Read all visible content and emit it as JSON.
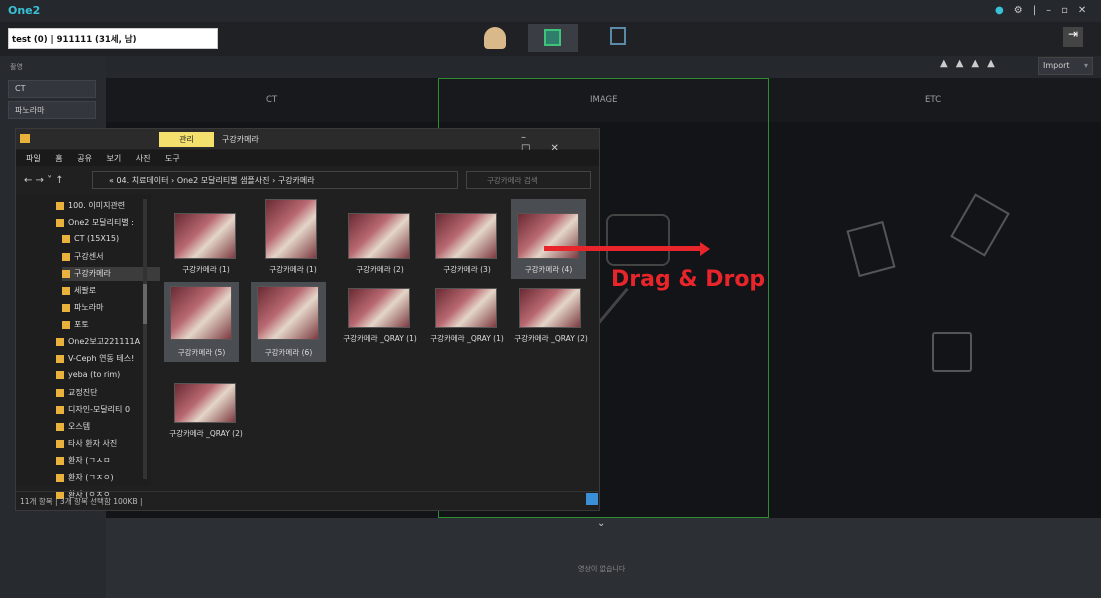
{
  "app": {
    "title": "One2",
    "window_controls": [
      "●",
      "⚙",
      "|",
      "–",
      "▫",
      "✕"
    ]
  },
  "patient": {
    "text": "test  (0) | 911111 (31세, 남)"
  },
  "sidebar": {
    "section": "촬영",
    "items": [
      {
        "label": "CT"
      },
      {
        "label": "파노라마"
      }
    ]
  },
  "toolbar": {
    "import_label": "Import"
  },
  "columns": {
    "ct": "CT",
    "image": "IMAGE",
    "etc": "ETC"
  },
  "bottom": {
    "empty_text": "영상이 없습니다"
  },
  "explorer": {
    "tab_manage": "관리",
    "title": "구강카메라",
    "ribbon": [
      "파일",
      "홈",
      "공유",
      "보기",
      "사진 도구"
    ],
    "path": [
      "« 04. 치료데이터",
      "One2 모달리티별 샘플사진",
      "구강카메라"
    ],
    "search_placeholder": "구강카메라 검색",
    "tree": [
      "100. 이미지관련",
      "One2 모달리티별 :",
      "CT (15X15)",
      "구강센서",
      "구강카메라",
      "세팔로",
      "파노라마",
      "포토",
      "One2보고221111A",
      "V-Ceph 연동 테스!",
      "yeba (to rim)",
      "교정진단",
      "디자인-모달리티 0",
      "오스템",
      "타사 환자 사진",
      "환자 (ㄱㅅㅁ",
      "환자 (ㄱㅈㅇ)",
      "환자 (ㅇㅈㅇ"
    ],
    "files": [
      "구강카메라 (1)",
      "구강카메라 (1)",
      "구강카메라 (2)",
      "구강카메라 (3)",
      "구강카메라 (4)",
      "구강카메라 (5)",
      "구강카메라 (6)",
      "구강카메라 _QRAY (1)",
      "구강카메라 _QRAY (1)",
      "구강카메라 _QRAY (2)",
      "구강카메라 _QRAY (2)"
    ],
    "status": "11개 항목  |  3개 항목 선택함 100KB  |"
  },
  "annotation": {
    "drag_drop": "Drag & Drop"
  }
}
